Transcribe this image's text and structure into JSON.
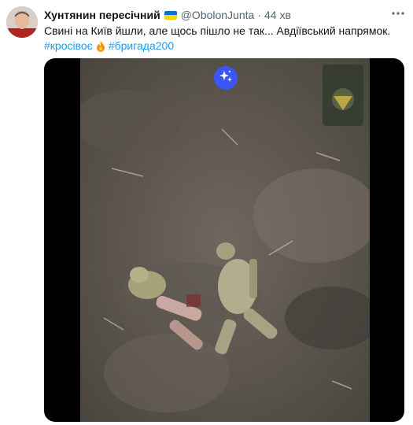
{
  "tweet": {
    "author_name": "Хунтянин пересічний",
    "handle": "@ObolonJunta",
    "separator": "·",
    "time": "44 хв",
    "text": "Свині на Київ йшли, але щось пішло не так... Авдіївський напрямок.",
    "hashtags": [
      "#кросівоє",
      "#бригада200"
    ]
  },
  "icons": {
    "verified_flag": "ukraine-flag-icon",
    "more": "more-options-icon",
    "fire": "fire-emoji-icon",
    "sparkle": "sparkle-icon"
  },
  "colors": {
    "link": "#1d9bf0",
    "text": "#0f1419",
    "muted": "#536471",
    "sparkle_button": "#3b56f5"
  }
}
